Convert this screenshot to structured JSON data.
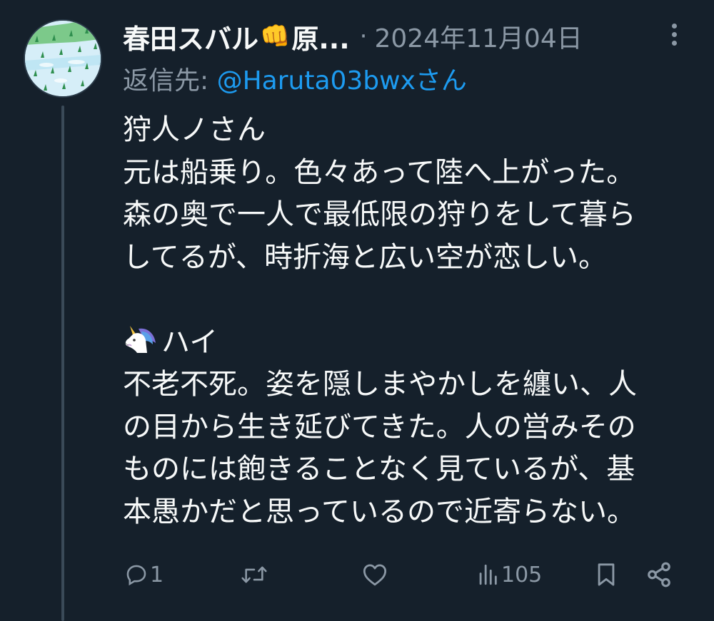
{
  "tweet": {
    "display_name": "春田スバル",
    "name_suffix": "原...",
    "separator": "·",
    "date": "2024年11月04日",
    "reply_prefix": "返信先: ",
    "reply_handle": "@Haruta03bwxさん",
    "lines": [
      "狩人ノさん",
      "元は船乗り。色々あって陸へ上がった。",
      "森の奥で一人で最低限の狩りをして暮ら",
      "してるが、時折海と広い空が恋しい。",
      "",
      "ハイ",
      "不老不死。姿を隠しまやかしを纏い、人",
      "の目から生き延びてきた。人の営みその",
      "ものには飽きることなく見ているが、基",
      "本愚かだと思っているので近寄らない。"
    ],
    "emoji": {
      "name_emoji": "👊",
      "unicorn": "unicorn-icon"
    }
  },
  "actions": {
    "reply_count": "1",
    "retweet_count": "",
    "like_count": "",
    "view_count": "105"
  },
  "icons": {
    "reply": "reply-icon",
    "retweet": "retweet-icon",
    "like": "heart-icon",
    "views": "views-icon",
    "bookmark": "bookmark-icon",
    "share": "share-icon",
    "more": "more-icon"
  },
  "colors": {
    "background": "#15202b",
    "text": "#f7f9f9",
    "muted": "#8b98a5",
    "link": "#1d9bf0"
  }
}
